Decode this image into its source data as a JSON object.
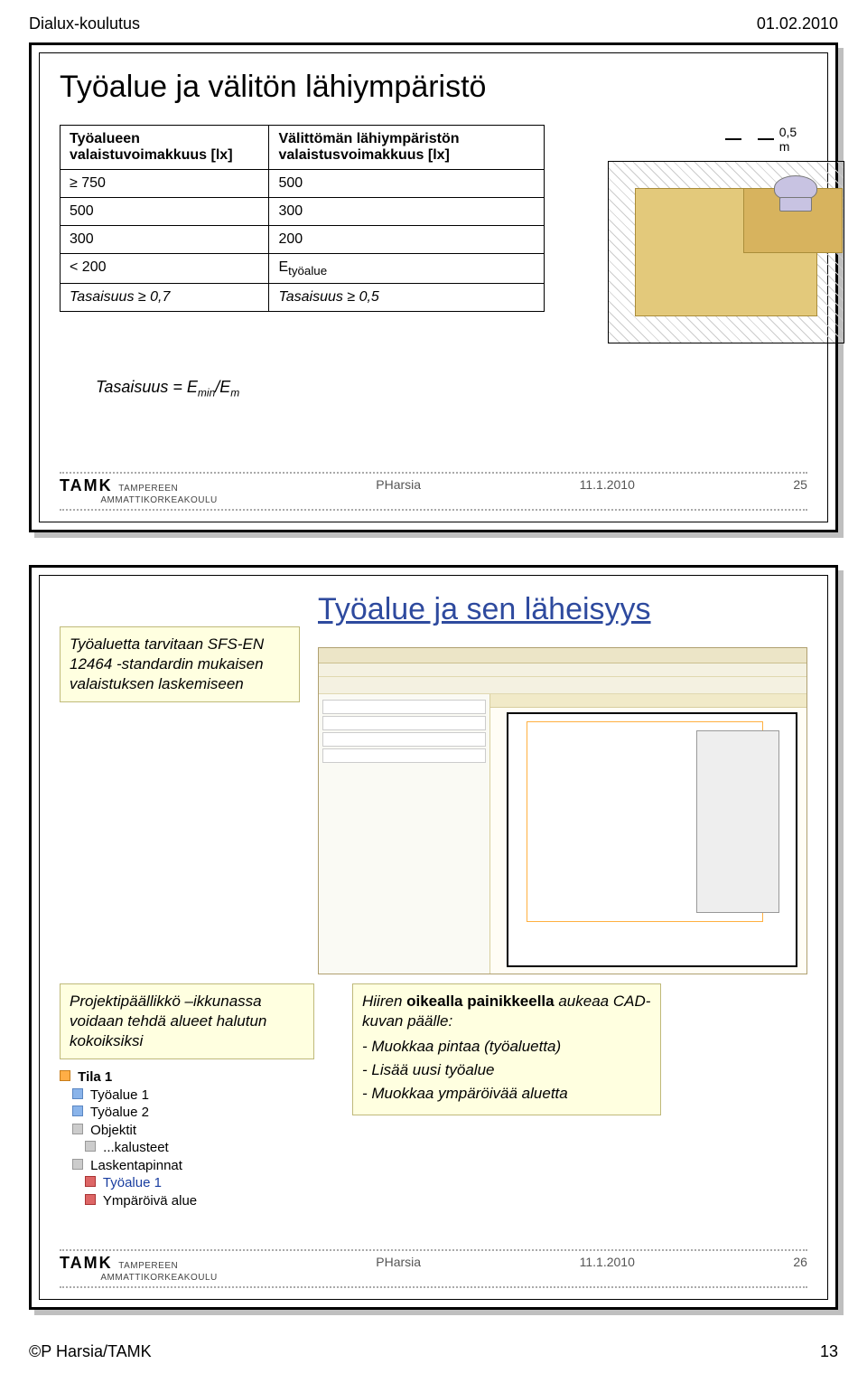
{
  "header": {
    "left": "Dialux-koulutus",
    "right": "01.02.2010"
  },
  "footer": {
    "left": "©P Harsia/TAMK",
    "right": "13"
  },
  "tamk": {
    "line1": "TAMK",
    "line2": "TAMPEREEN",
    "line3": "AMMATTIKORKEAKOULU",
    "author": "PHarsia",
    "date": "11.1.2010"
  },
  "slide1": {
    "title": "Työalue ja välitön lähiympäristö",
    "table": {
      "head1": "Työalueen valaistuvoimakkuus [lx]",
      "head2": "Välittömän lähiympäristön valaistusvoimakkuus [lx]",
      "rows": [
        {
          "c1": "≥ 750",
          "c2": "500"
        },
        {
          "c1": "500",
          "c2": "300"
        },
        {
          "c1": "300",
          "c2": "200"
        },
        {
          "c1": "< 200",
          "c2": "Etyöalue",
          "c2_is_formula": true
        },
        {
          "c1": "Tasaisuus ≥ 0,7",
          "c2": "Tasaisuus ≥ 0,5",
          "ital": true
        }
      ]
    },
    "dim_label": "0,5 m",
    "formula_text": "Tasaisuus = Emin/Em",
    "page_no": "25"
  },
  "slide2": {
    "title": "Työalue ja sen läheisyys",
    "note_left": "Työaluetta tarvitaan SFS-EN 12464 -standardin mukaisen valaistuksen laskemiseen",
    "note_pp": "Projektipäällikkö –ikkunassa voidaan tehdä alueet halutun kokoiksiksi",
    "note_right_head": "Hiiren oikealla painikkeella aukeaa CAD-kuvan päälle:",
    "note_right_items": [
      "- Muokkaa pintaa (työaluetta)",
      "- Lisää uusi työalue",
      "- Muokkaa ympäröivää aluetta"
    ],
    "tree": {
      "root": "Tila 1",
      "children": [
        "Työalue 1",
        "Työalue 2",
        "Objektit",
        "...kalusteet",
        "Laskentapinnat",
        "Työalue 1",
        "Ympäröivä alue"
      ]
    },
    "page_no": "26"
  }
}
